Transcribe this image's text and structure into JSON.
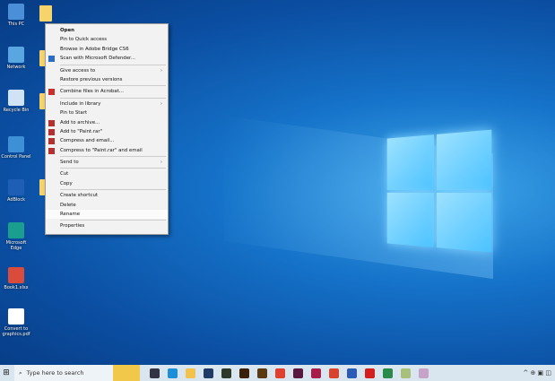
{
  "desktop_icons": [
    {
      "label": "This PC",
      "color": "#4a8fd8"
    },
    {
      "label": "Network",
      "color": "#5aa6e0"
    },
    {
      "label": "Recycle Bin",
      "color": "#cfe3f5"
    },
    {
      "label": "Control Panel",
      "color": "#3d8fd6"
    },
    {
      "label": "AdBlock",
      "color": "#1e5eb5"
    },
    {
      "label": "Microsoft Edge",
      "color": "#1a9f8f"
    },
    {
      "label": "Book1.xlsx",
      "color": "#d94b3a"
    },
    {
      "label": "Convert to graphics.pdf",
      "color": "#ffffff"
    }
  ],
  "context_menu": {
    "items": [
      {
        "label": "Open",
        "bold": true
      },
      {
        "label": "Pin to Quick access"
      },
      {
        "label": "Browse in Adobe Bridge CS6"
      },
      {
        "label": "Scan with Microsoft Defender...",
        "icon": "defender-icon",
        "color": "#2b6cc4"
      },
      {
        "sep": true
      },
      {
        "label": "Give access to",
        "submenu": true
      },
      {
        "label": "Restore previous versions"
      },
      {
        "sep": true
      },
      {
        "label": "Combine files in Acrobat...",
        "icon": "acrobat-icon",
        "color": "#c7302b"
      },
      {
        "sep": true
      },
      {
        "label": "Include in library",
        "submenu": true
      },
      {
        "label": "Pin to Start"
      },
      {
        "label": "Add to archive...",
        "icon": "winrar-icon",
        "color": "#b53030"
      },
      {
        "label": "Add to \"Paint.rar\"",
        "icon": "winrar-icon",
        "color": "#b53030"
      },
      {
        "label": "Compress and email...",
        "icon": "winrar-icon",
        "color": "#b53030"
      },
      {
        "label": "Compress to \"Paint.rar\" and email",
        "icon": "winrar-icon",
        "color": "#b53030"
      },
      {
        "sep": true
      },
      {
        "label": "Send to",
        "submenu": true
      },
      {
        "sep": true
      },
      {
        "label": "Cut"
      },
      {
        "label": "Copy"
      },
      {
        "sep": true
      },
      {
        "label": "Create shortcut"
      },
      {
        "label": "Delete"
      },
      {
        "label": "Rename",
        "highlight": true
      },
      {
        "sep": true
      },
      {
        "label": "Properties"
      }
    ]
  },
  "taskbar": {
    "search_placeholder": "Type here to search",
    "apps": [
      {
        "name": "task-view-icon",
        "color": "#334"
      },
      {
        "name": "edge-icon",
        "color": "#1d8fd8"
      },
      {
        "name": "file-explorer-icon",
        "color": "#f3c24a"
      },
      {
        "name": "photoshop-icon",
        "color": "#1f3b66"
      },
      {
        "name": "app-icon",
        "color": "#2d3a2a"
      },
      {
        "name": "illustrator-icon",
        "color": "#3a1f0a"
      },
      {
        "name": "illustrator-icon",
        "color": "#5a3a10"
      },
      {
        "name": "chrome-icon",
        "color": "#e0402f"
      },
      {
        "name": "indesign-icon",
        "color": "#5a1840"
      },
      {
        "name": "indesign-icon",
        "color": "#a81d4a"
      },
      {
        "name": "chrome-icon",
        "color": "#d9442f"
      },
      {
        "name": "word-icon",
        "color": "#2b5cb5"
      },
      {
        "name": "acrobat-icon",
        "color": "#d3201f"
      },
      {
        "name": "excel-icon",
        "color": "#2a8a4a"
      },
      {
        "name": "app-icon",
        "color": "#a8c07a"
      },
      {
        "name": "app-icon",
        "color": "#c7a2c9"
      }
    ],
    "tray": "^ ⊕ ▣ ◫"
  }
}
